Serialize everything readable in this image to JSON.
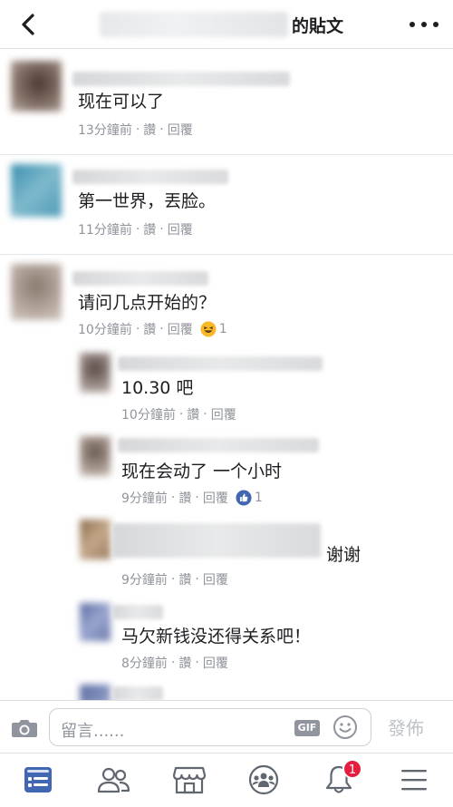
{
  "header": {
    "title": "的貼文"
  },
  "comments": [
    {
      "text": "现在可以了",
      "time": "13分鐘前",
      "like": "讚",
      "reply": "回覆"
    },
    {
      "text": "第一世界，丟脸。",
      "time": "11分鐘前",
      "like": "讚",
      "reply": "回覆"
    },
    {
      "text": "请问几点开始的？",
      "time": "10分鐘前",
      "like": "讚",
      "reply": "回覆",
      "reaction": {
        "type": "haha",
        "count": "1"
      }
    }
  ],
  "replies": [
    {
      "text": "10.30 吧",
      "time": "10分鐘前",
      "like": "讚",
      "reply": "回覆"
    },
    {
      "text": "现在会动了 一个小时",
      "time": "9分鐘前",
      "like": "讚",
      "reply": "回覆",
      "reaction": {
        "type": "like",
        "count": "1"
      }
    },
    {
      "text": "谢谢",
      "time": "9分鐘前",
      "like": "讚",
      "reply": "回覆"
    },
    {
      "text": "马欠新钱没还得关系吧！",
      "time": "8分鐘前",
      "like": "讚",
      "reply": "回覆"
    }
  ],
  "composer": {
    "placeholder": "留言......",
    "gif_label": "GIF",
    "post_label": "發佈"
  },
  "tabbar": {
    "notifications_badge": "1"
  },
  "colors": {
    "brand": "#4267b2",
    "meta_text": "#90949c",
    "badge": "#e41e3f"
  }
}
